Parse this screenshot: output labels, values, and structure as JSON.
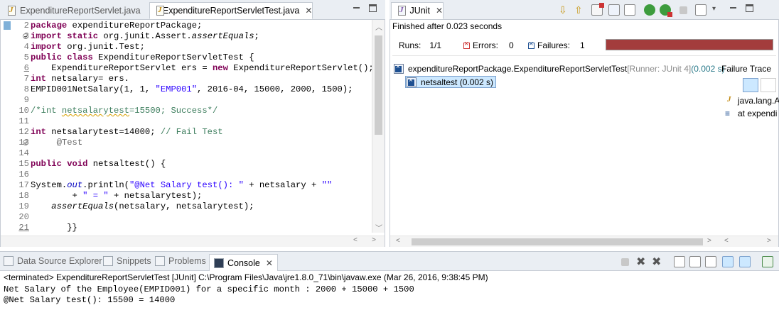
{
  "editor": {
    "tabs": [
      {
        "label": "ExpenditureReportServlet.java",
        "active": false
      },
      {
        "label": "*ExpenditureReportServletTest.java",
        "active": true
      }
    ],
    "line_numbers": [
      "2",
      "3",
      "4",
      "5",
      "6",
      "7",
      "8",
      "9",
      "10",
      "11",
      "12",
      "13",
      "14",
      "15",
      "16",
      "17",
      "18",
      "19",
      "20",
      "21"
    ],
    "code": {
      "l2_kw": "package",
      "l2_rest": " expenditureReportPackage;",
      "l3_kw1": "import",
      "l3_kw2": " static",
      "l3_rest": " org.junit.Assert.",
      "l3_method": "assertEquals",
      "l3_end": ";",
      "l4_kw": "import",
      "l4_rest": " org.junit.Test;",
      "l5_kw1": "public",
      "l5_kw2": " class",
      "l5_rest": " ExpenditureReportServletTest {",
      "l6_a": "    ExpenditureReportServlet ers = ",
      "l6_kw": "new",
      "l6_b": " ExpenditureReportServlet();",
      "l7_kw": "int",
      "l7_rest": " netsalary= ers.",
      "l8_a": "EMPID001NetSalary(1, 1, ",
      "l8_str": "\"EMP001\"",
      "l8_b": ", 2016-04, 15000, 2000, 1500);",
      "l10_cmt_a": "/*int ",
      "l10_cmt_sq": "netsalarytest",
      "l10_cmt_b": "=15500; Success*/",
      "l12_kw": "int",
      "l12_rest": " netsalarytest=14000; ",
      "l12_cmt": "// Fail Test",
      "l13_ann": "     @Test",
      "l15_kw": "public",
      "l15_kw2": " void",
      "l15_rest": " netsaltest() {",
      "l17_a": "System.",
      "l17_out": "out",
      "l17_b": ".println(",
      "l17_str": "\"@Net Salary test(): \"",
      "l17_c": " + netsalary + ",
      "l17_str2": "\"\"",
      "l18_a": "        + ",
      "l18_str": "\" = \"",
      "l18_b": " + netsalarytest);",
      "l19_a": "    ",
      "l19_method": "assertEquals",
      "l19_b": "(netsalary, netsalarytest);",
      "l21_a": "       }}"
    }
  },
  "junit": {
    "tab_label": "JUnit",
    "finished": "Finished after 0.023 seconds",
    "runs_label": "Runs:",
    "runs_value": "1/1",
    "errors_label": "Errors:",
    "errors_value": "0",
    "failures_label": "Failures:",
    "failures_value": "1",
    "progress_status": "failed",
    "progress_fraction": 1.0,
    "tree_root_name": "expenditureReportPackage.ExpenditureReportServletTest",
    "tree_root_runner": " [Runner: JUnit 4]",
    "tree_root_time": " (0.002 s)",
    "tree_child": "netsaltest (0.002 s)",
    "failure_trace_title": "Failure Trace",
    "trace_lines": [
      "java.lang.A",
      "at expendi"
    ]
  },
  "console": {
    "tabs": [
      {
        "label": "Data Source Explorer",
        "active": false
      },
      {
        "label": "Snippets",
        "active": false
      },
      {
        "label": "Problems",
        "active": false
      },
      {
        "label": "Console",
        "active": true
      }
    ],
    "terminated": "<terminated> ExpenditureReportServletTest [JUnit] C:\\Program Files\\Java\\jre1.8.0_71\\bin\\javaw.exe (Mar 26, 2016, 9:38:45 PM)",
    "output": [
      "Net Salary of the Employee(EMPID001) for a specific month : 2000 + 15000 + 1500",
      "@Net Salary test(): 15500 = 14000"
    ]
  },
  "colors": {
    "failure_bar": "#a33c3c",
    "keyword": "#7f0055",
    "string": "#2a00ff",
    "comment": "#3f7f5f"
  },
  "icons": [
    "java-file-icon",
    "close-icon",
    "minimize-icon",
    "maximize-icon",
    "junit-icon",
    "next-failure-icon",
    "previous-failure-icon",
    "show-failures-only-icon",
    "scroll-lock-icon",
    "history-icon",
    "rerun-icon",
    "rerun-failed-first-icon",
    "stop-icon",
    "view-menu-icon",
    "test-suite-failed-icon",
    "test-failed-icon",
    "filter-trace-icon",
    "compare-icon",
    "stack-trace-icon",
    "console-icon",
    "terminate-icon",
    "remove-launch-icon",
    "remove-all-icon",
    "pin-console-icon",
    "open-console-icon"
  ]
}
